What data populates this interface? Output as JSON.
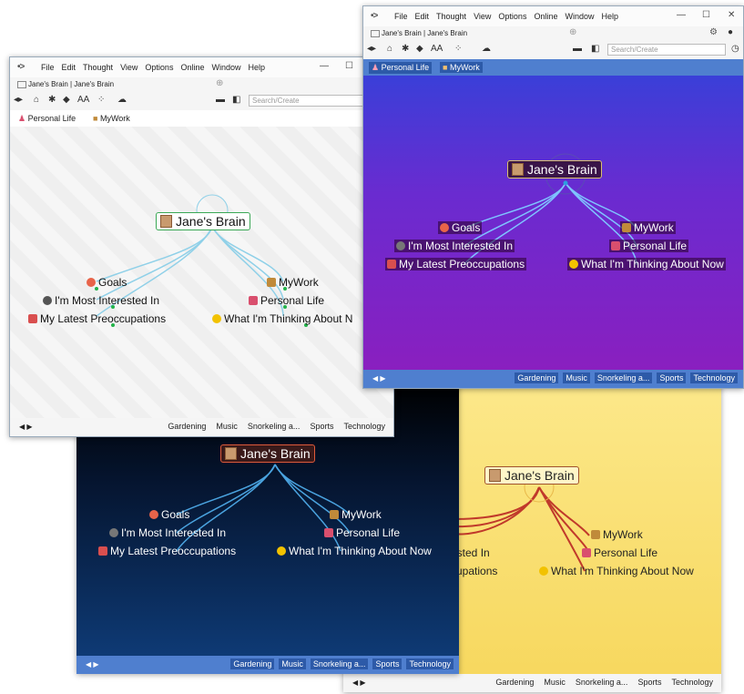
{
  "app": {
    "menu": [
      "File",
      "Edit",
      "Thought",
      "View",
      "Options",
      "Online",
      "Window",
      "Help"
    ],
    "tab_title": "Jane's Brain | Jane's Brain",
    "search_placeholder": "Search/Create",
    "font_size_label": "AA"
  },
  "pins": [
    "Personal Life",
    "MyWork"
  ],
  "central_thought": "Jane's Brain",
  "children_left": [
    "Goals",
    "I'm Most Interested In",
    "My Latest Preoccupations"
  ],
  "children_right": [
    "MyWork",
    "Personal Life",
    "What I'm Thinking About Now"
  ],
  "tags": [
    "Gardening",
    "Music",
    "Snorkeling a...",
    "Sports",
    "Technology"
  ],
  "partial": {
    "interested": "ested In",
    "preoccupations": "cupations",
    "thinking_white": "What I'm Thinking About N"
  },
  "colors": {
    "white_theme_bg": "#f4f4f4",
    "blue_theme_bg": "#0b2a55",
    "purple_theme_bg": "#6a2bd0",
    "yellow_theme_bg": "#fbe27a",
    "toolbar_blue": "#4f7fcf",
    "dot_blue": "#2f9fdf",
    "dot_green": "#23b34a"
  }
}
